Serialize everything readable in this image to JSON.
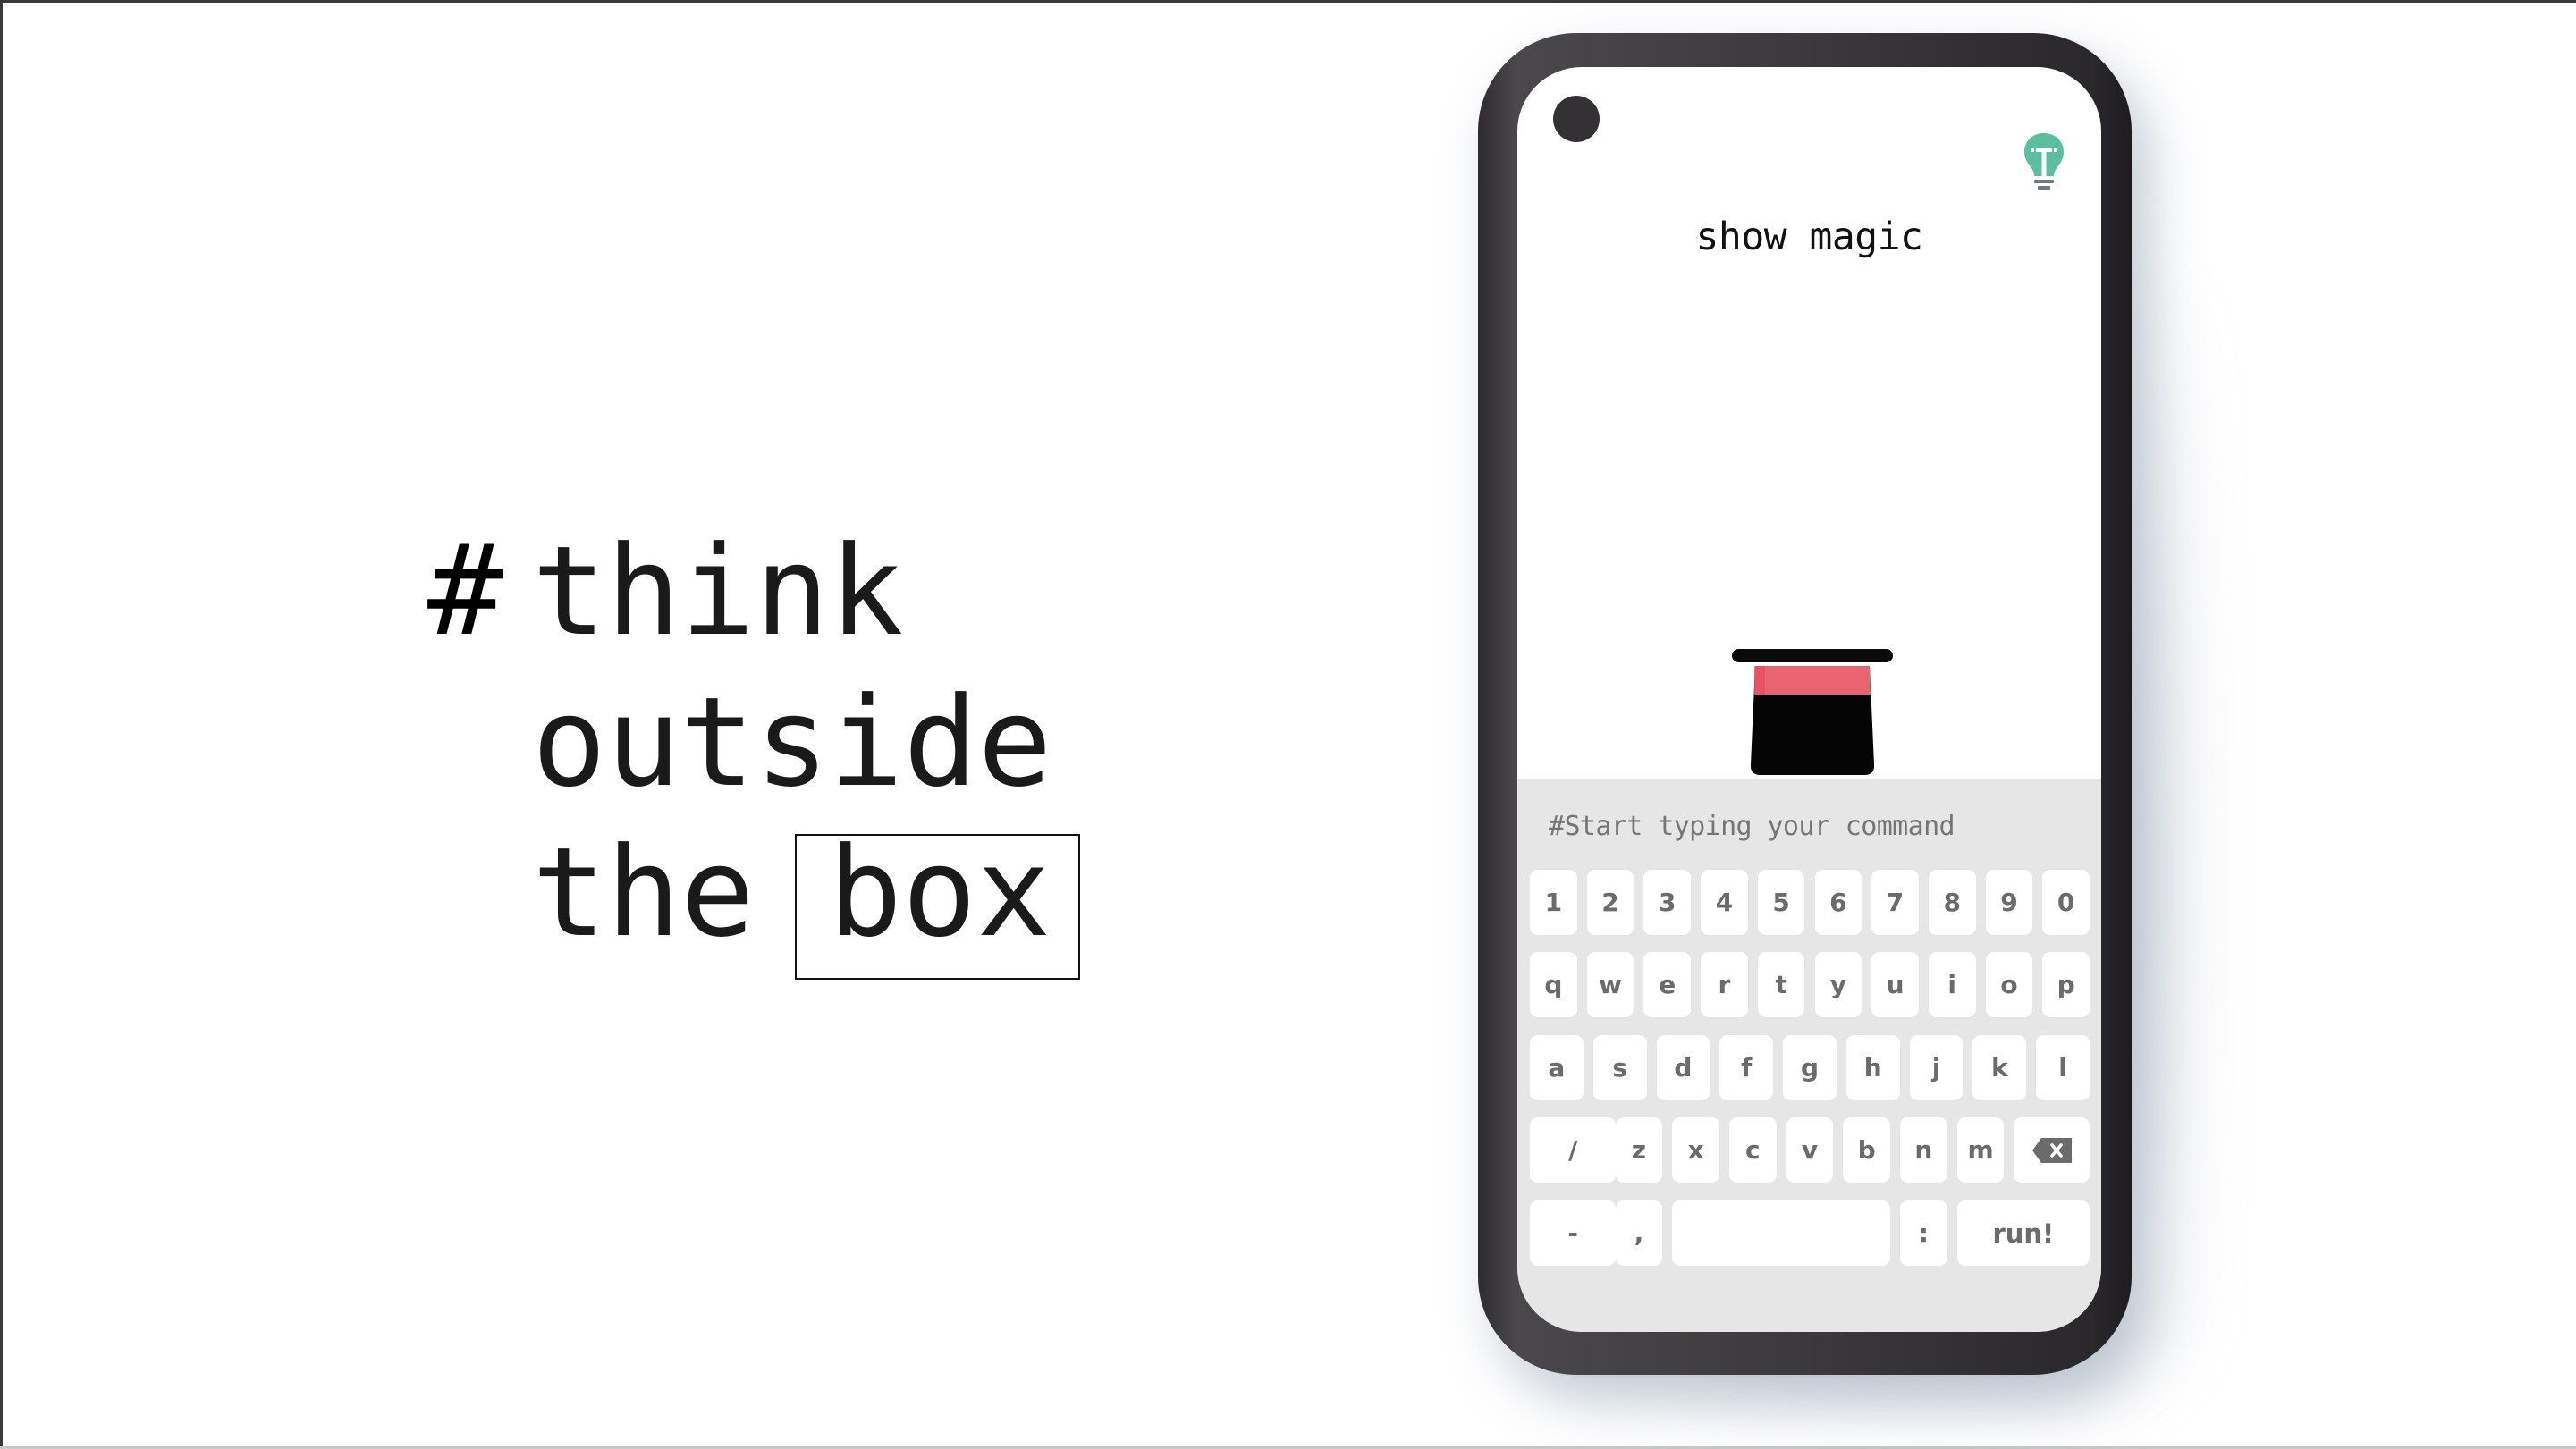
{
  "tagline": {
    "hash": "#",
    "line1": "think",
    "line2": "outside",
    "line3": "the",
    "boxed_word": "box"
  },
  "app": {
    "title": "show magic",
    "hint_icon": "lightbulb-icon",
    "hero_icon": "magic-top-hat-icon",
    "command_input": {
      "value": "",
      "placeholder": "#Start typing your command"
    },
    "colors": {
      "accent": "#5bbf9f",
      "hat_band": "#ea6370",
      "hat_body": "#050505",
      "keyboard_bg": "#e6e6e6",
      "key_text": "#6b6b6b",
      "phone_body": "#3b393c"
    }
  },
  "keyboard": {
    "row1": [
      "1",
      "2",
      "3",
      "4",
      "5",
      "6",
      "7",
      "8",
      "9",
      "0"
    ],
    "row2": [
      "q",
      "w",
      "e",
      "r",
      "t",
      "y",
      "u",
      "i",
      "o",
      "p"
    ],
    "row3": [
      "a",
      "s",
      "d",
      "f",
      "g",
      "h",
      "j",
      "k",
      "l"
    ],
    "row4": [
      "/",
      "z",
      "x",
      "c",
      "v",
      "b",
      "n",
      "m"
    ],
    "row4_backspace_icon": "backspace-icon",
    "row5": {
      "dash": "-",
      "comma": ",",
      "space": "",
      "colon": ":",
      "run": "run!"
    }
  }
}
